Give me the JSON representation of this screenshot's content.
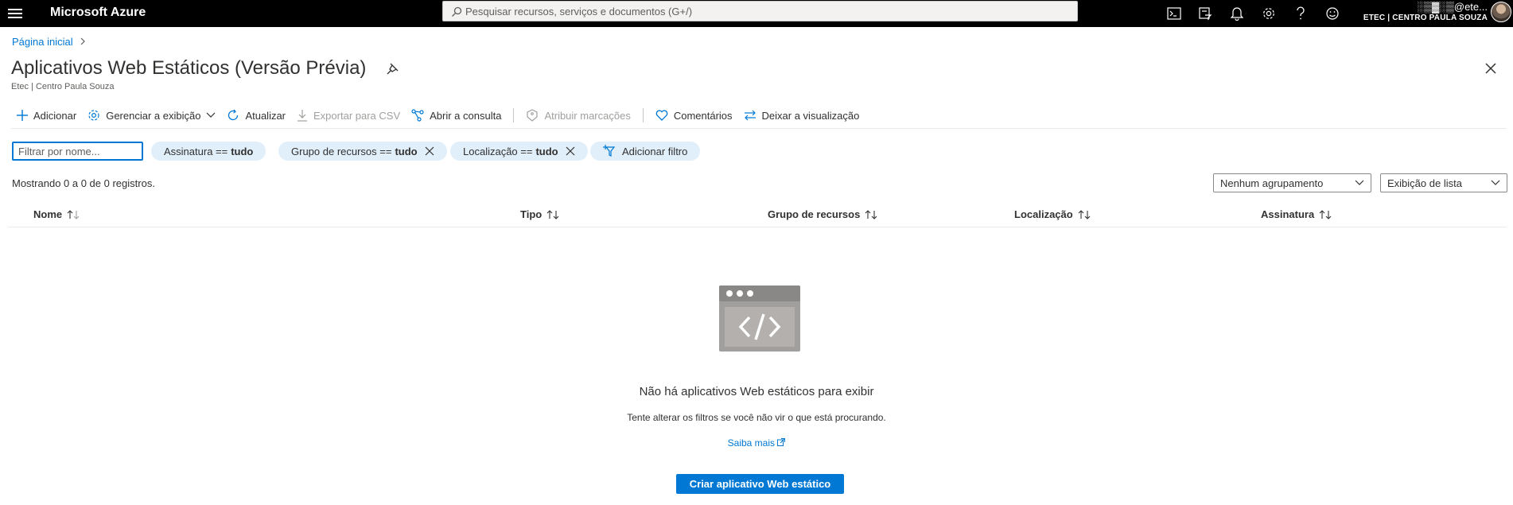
{
  "topbar": {
    "brand": "Microsoft Azure",
    "search_placeholder": "Pesquisar recursos, serviços e documentos (G+/)",
    "account_email": "░▒▓░▒@ete...",
    "account_tenant": "ETEC | CENTRO PAULA SOUZA",
    "icons": [
      "cloud-shell-icon",
      "directory-filter-icon",
      "notifications-icon",
      "settings-icon",
      "help-icon",
      "feedback-icon"
    ]
  },
  "breadcrumb": {
    "home": "Página inicial"
  },
  "header": {
    "title": "Aplicativos Web Estáticos (Versão Prévia)",
    "subtitle": "Etec | Centro Paula Souza"
  },
  "commands": {
    "add": "Adicionar",
    "manage_view": "Gerenciar a exibição",
    "refresh": "Atualizar",
    "export_csv": "Exportar para CSV",
    "open_query": "Abrir a consulta",
    "assign_tags": "Atribuir marcações",
    "feedback": "Comentários",
    "leave_preview": "Deixar a visualização"
  },
  "filters": {
    "name_placeholder": "Filtrar por nome...",
    "subscription": {
      "key": "Assinatura ==",
      "value": "tudo"
    },
    "resource_group": {
      "key": "Grupo de recursos ==",
      "value": "tudo"
    },
    "location": {
      "key": "Localização ==",
      "value": "tudo"
    },
    "add_filter": "Adicionar filtro"
  },
  "records_text": "Mostrando 0 a 0 de 0 registros.",
  "grouping": {
    "selected": "Nenhum agrupamento"
  },
  "view_mode": {
    "selected": "Exibição de lista"
  },
  "table": {
    "columns": [
      "Nome",
      "Tipo",
      "Grupo de recursos",
      "Localização",
      "Assinatura"
    ]
  },
  "empty_state": {
    "title": "Não há aplicativos Web estáticos para exibir",
    "subtitle": "Tente alterar os filtros se você não vir o que está procurando.",
    "learn_more": "Saiba mais",
    "create_button": "Criar aplicativo Web estático"
  },
  "colors": {
    "topbar": "#000000",
    "accent": "#0078d4",
    "pill_bg": "#e1effb",
    "disabled": "#a19f9d"
  }
}
